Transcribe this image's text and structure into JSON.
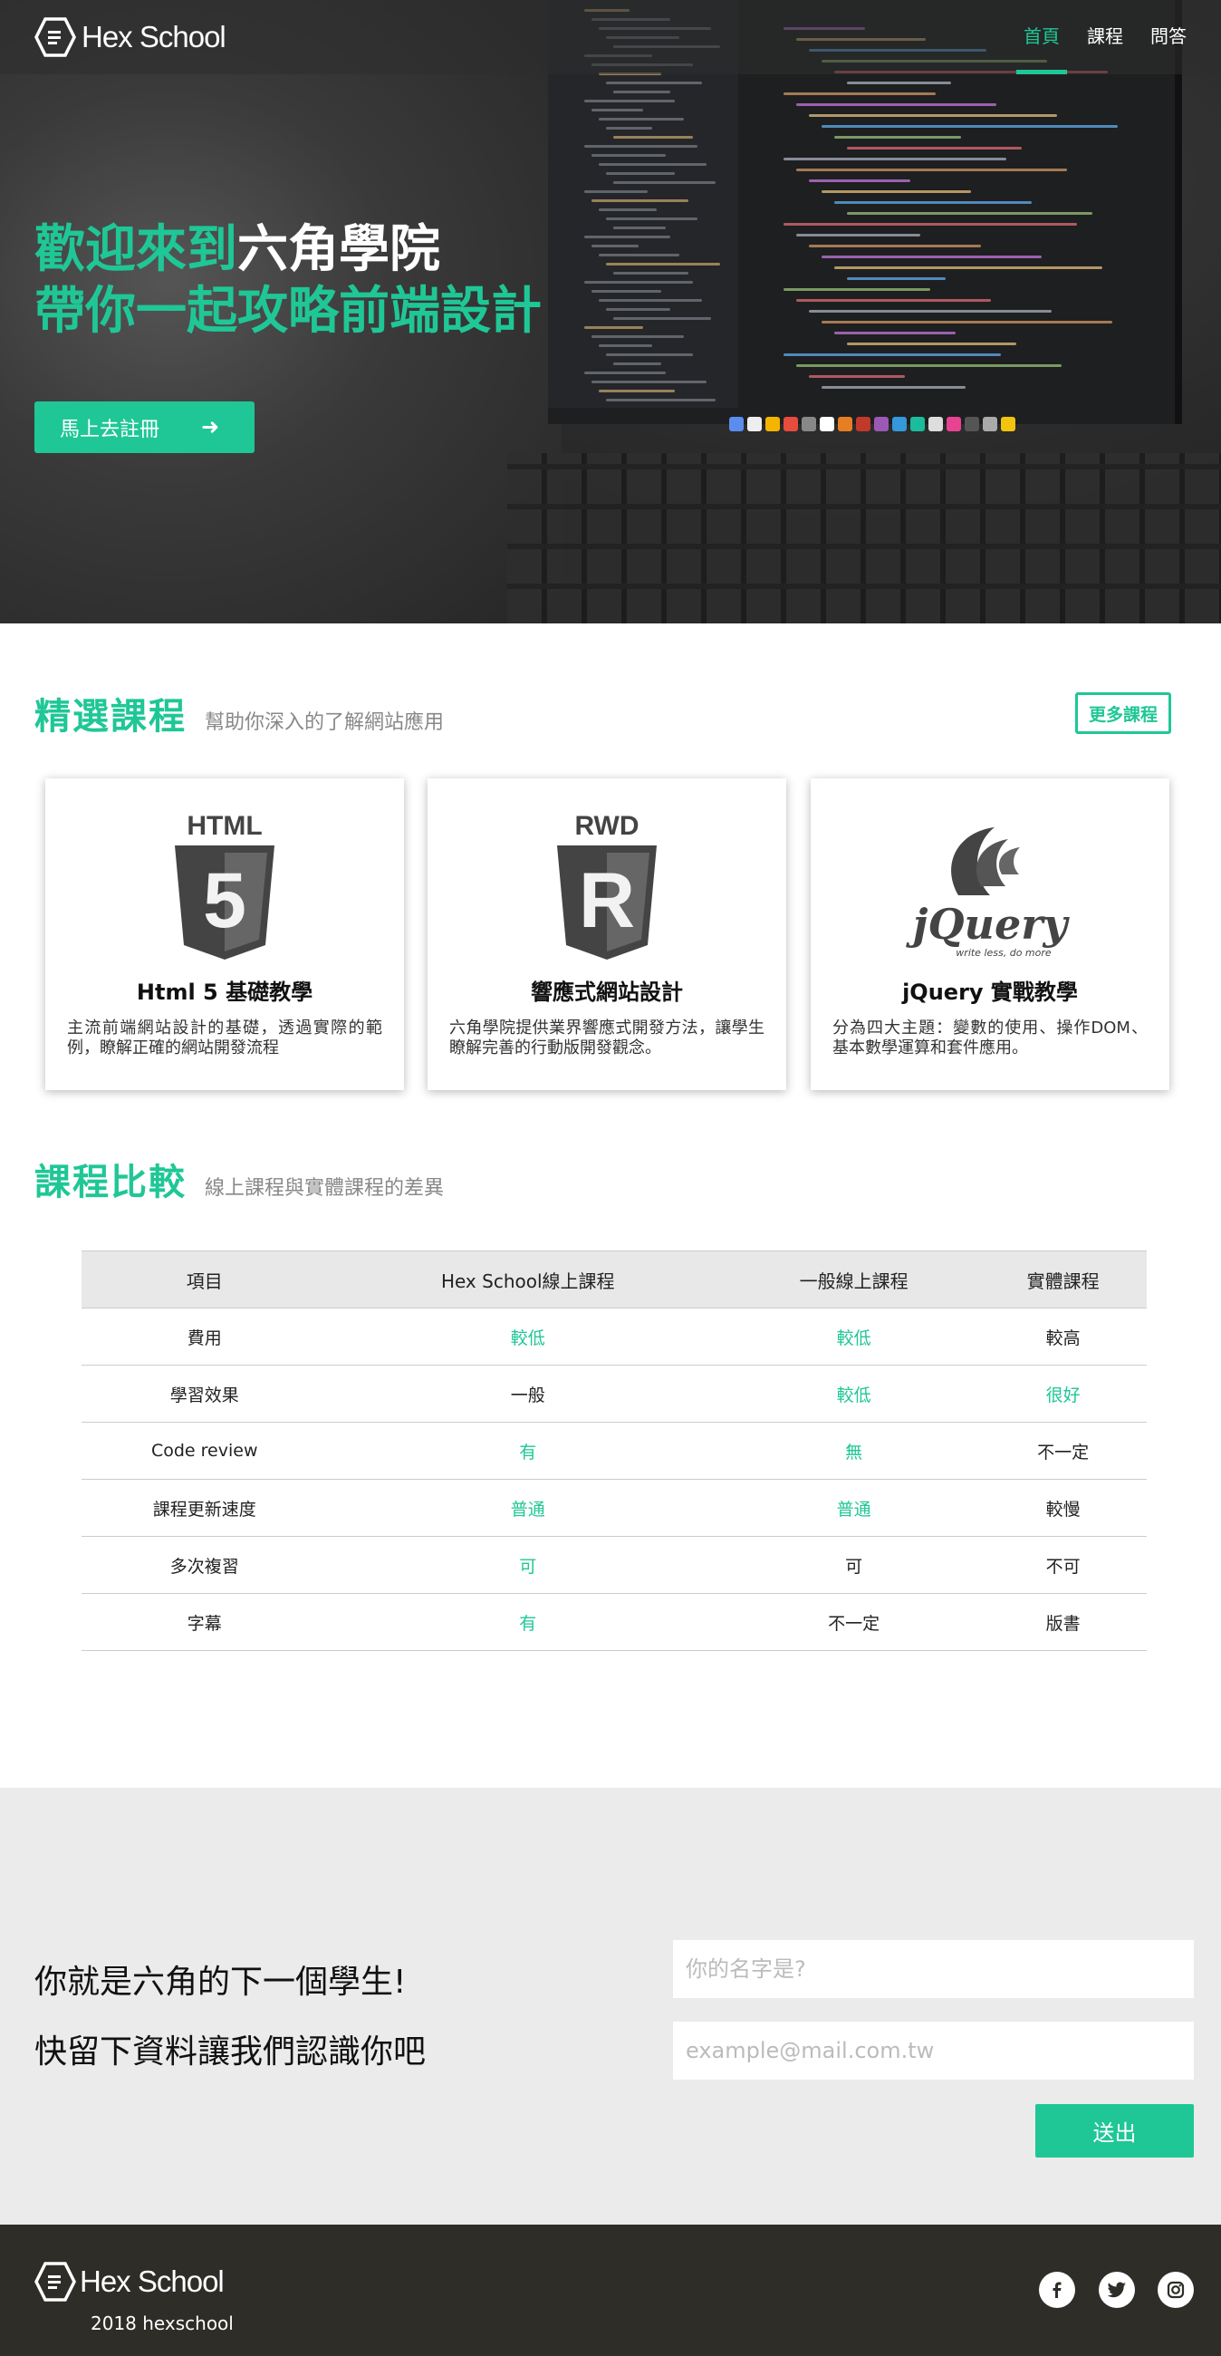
{
  "brand": {
    "name": "Hex School"
  },
  "nav": {
    "items": [
      "首頁",
      "課程",
      "問答"
    ],
    "active": 0
  },
  "hero": {
    "line1_green": "歡迎來到",
    "line1_white": "六角學院",
    "line2": "帶你一起攻略前端設計",
    "cta_label": "馬上去註冊",
    "cta_arrow": "➜"
  },
  "featured": {
    "title": "精選課程",
    "subtitle": "幫助你深入的了解網站應用",
    "more_label": "更多課程",
    "cards": [
      {
        "badge": "HTML",
        "glyph": "5",
        "title": "Html 5 基礎教學",
        "desc": "主流前端網站設計的基礎，透過實際的範例，瞭解正確的網站開發流程"
      },
      {
        "badge": "RWD",
        "glyph": "R",
        "title": "響應式網站設計",
        "desc": "六角學院提供業界響應式開發方法，讓學生瞭解完善的行動版開發觀念。"
      },
      {
        "badge": "jQuery",
        "tagline": "write less, do more",
        "title": "jQuery 實戰教學",
        "desc": "分為四大主題：變數的使用、操作DOM、基本數學運算和套件應用。"
      }
    ]
  },
  "comparison": {
    "title": "課程比較",
    "subtitle": "線上課程與實體課程的差異",
    "headers": [
      "項目",
      "Hex School線上課程",
      "一般線上課程",
      "實體課程"
    ],
    "rows": [
      [
        "費用",
        "較低",
        "較低",
        "較高"
      ],
      [
        "學習效果",
        "一般",
        "較低",
        "很好"
      ],
      [
        "Code review",
        "有",
        "無",
        "不一定"
      ],
      [
        "課程更新速度",
        "普通",
        "普通",
        "較慢"
      ],
      [
        "多次複習",
        "可",
        "可",
        "不可"
      ],
      [
        "字幕",
        "有",
        "不一定",
        "版書"
      ]
    ],
    "highlight": [
      [
        false,
        true,
        true,
        false
      ],
      [
        false,
        false,
        true,
        true
      ],
      [
        false,
        true,
        true,
        false
      ],
      [
        false,
        true,
        true,
        false
      ],
      [
        false,
        true,
        false,
        false
      ],
      [
        false,
        true,
        false,
        false
      ]
    ]
  },
  "signup": {
    "line1": "你就是六角的下一個學生!",
    "line2": "快留下資料讓我們認識你吧",
    "name_placeholder": "你的名字是?",
    "email_placeholder": "example@mail.com.tw",
    "submit_label": "送出"
  },
  "footer": {
    "copyright": "2018 hexschool",
    "social": [
      "facebook-icon",
      "twitter-icon",
      "instagram-icon"
    ]
  },
  "colors": {
    "accent": "#1fc796",
    "footer": "#2e2d28",
    "signup_bg": "#ebebeb"
  }
}
